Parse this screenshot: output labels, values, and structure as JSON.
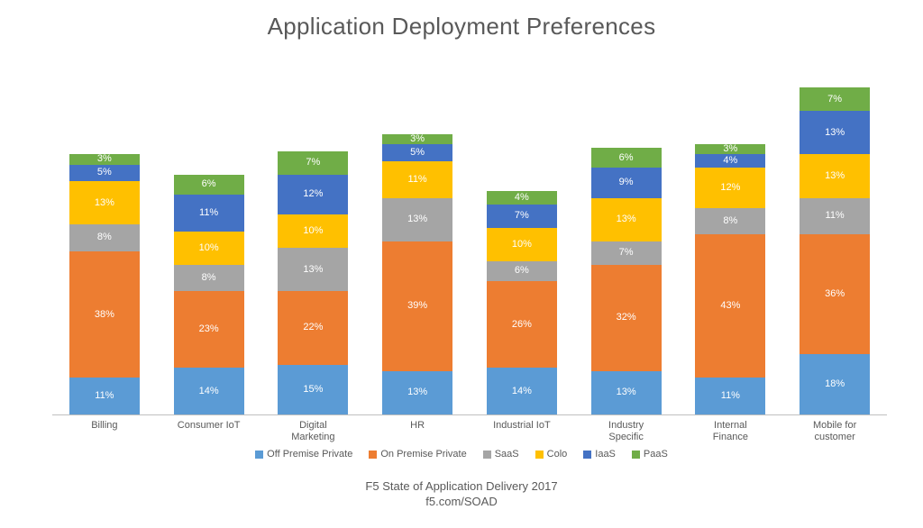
{
  "title": "Application Deployment Preferences",
  "footer_line1": "F5 State of Application Delivery 2017",
  "footer_line2": "f5.com/SOAD",
  "chart_data": {
    "type": "bar",
    "stacked": true,
    "title": "Application Deployment Preferences",
    "xlabel": "",
    "ylabel": "",
    "y_format": "percent",
    "ylim": [
      0,
      100
    ],
    "scale_note": "Bars drawn against ~100% visual max; totals per category do not sum to 100%.",
    "categories": [
      "Billing",
      "Consumer IoT",
      "Digital Marketing",
      "HR",
      "Industrial IoT",
      "Industry Specific",
      "Internal Finance",
      "Mobile for customer"
    ],
    "series": [
      {
        "name": "Off Premise Private",
        "color": "#5B9BD5",
        "values": [
          11,
          14,
          15,
          13,
          14,
          13,
          11,
          18
        ]
      },
      {
        "name": "On Premise Private",
        "color": "#ED7D31",
        "values": [
          38,
          23,
          22,
          39,
          26,
          32,
          43,
          36
        ]
      },
      {
        "name": "SaaS",
        "color": "#A5A5A5",
        "values": [
          8,
          8,
          13,
          13,
          6,
          7,
          8,
          11
        ]
      },
      {
        "name": "Colo",
        "color": "#FFC000",
        "values": [
          13,
          10,
          10,
          11,
          10,
          13,
          12,
          13
        ]
      },
      {
        "name": "IaaS",
        "color": "#4472C4",
        "values": [
          5,
          11,
          12,
          5,
          7,
          9,
          4,
          13
        ]
      },
      {
        "name": "PaaS",
        "color": "#70AD47",
        "values": [
          3,
          6,
          7,
          3,
          4,
          6,
          3,
          7
        ]
      }
    ],
    "legend_position": "bottom"
  }
}
